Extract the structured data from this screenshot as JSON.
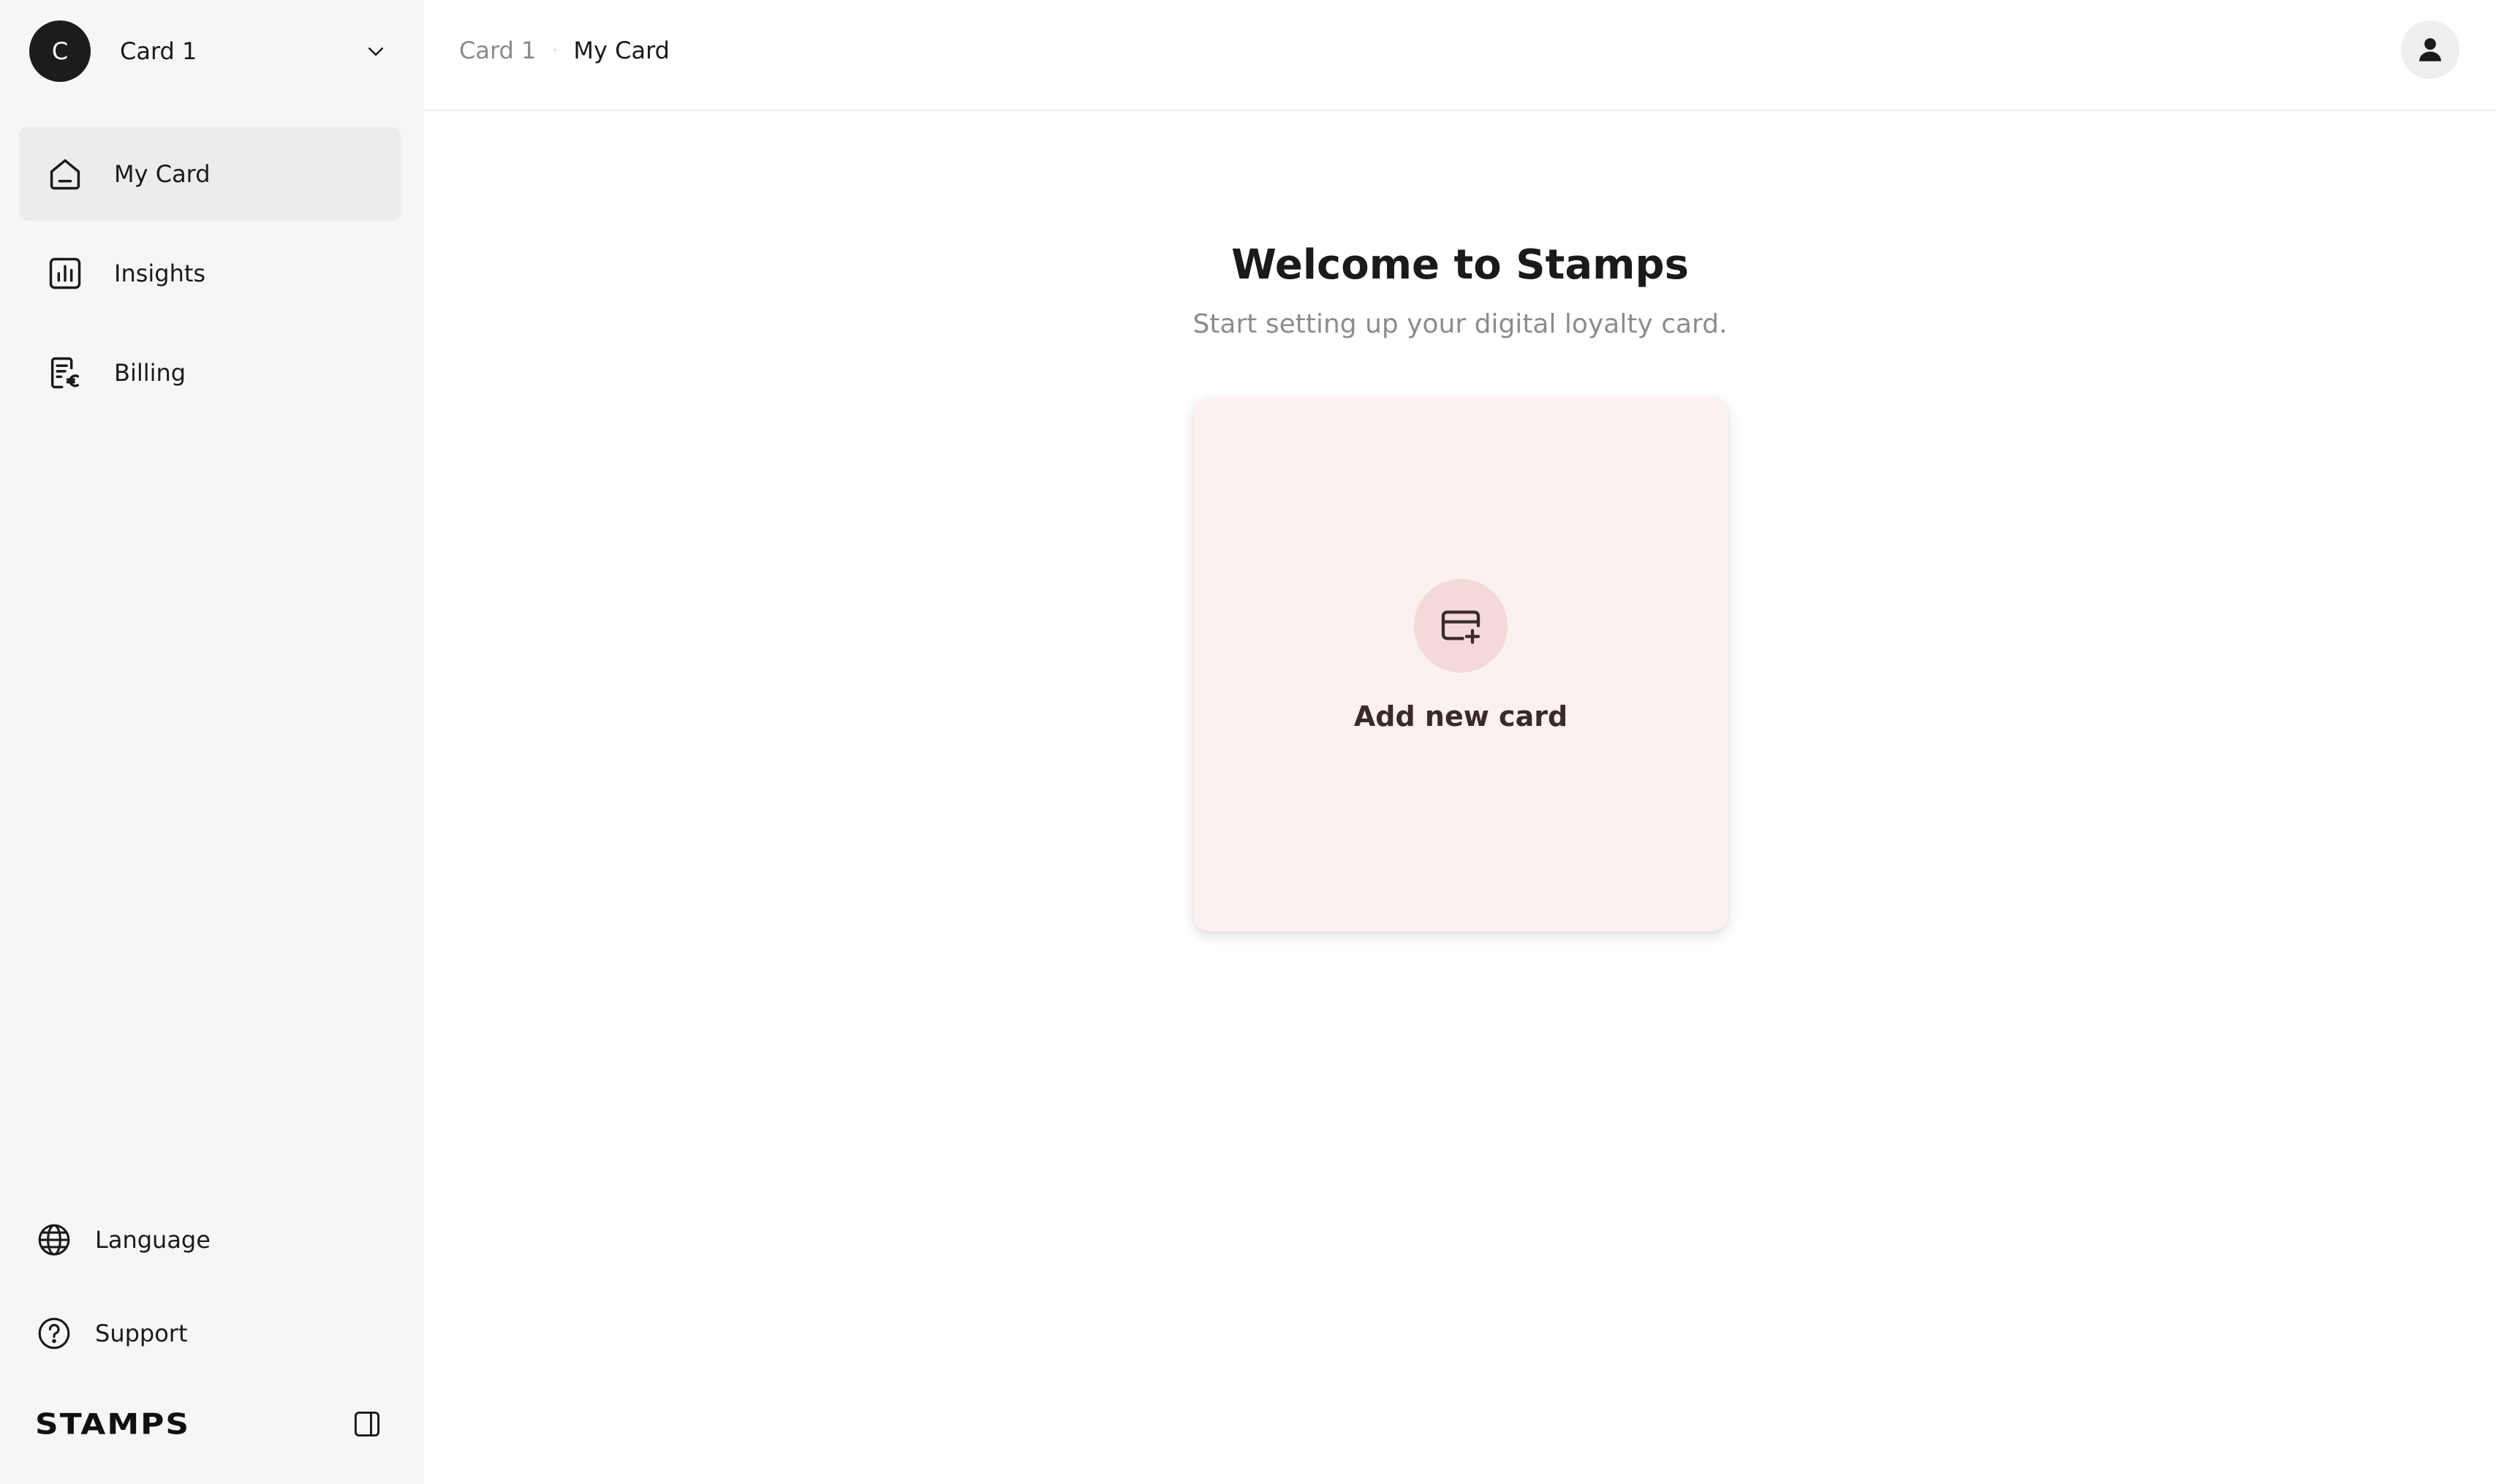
{
  "sidebar": {
    "workspace": {
      "avatar_letter": "C",
      "name": "Card 1"
    },
    "nav_items": [
      {
        "label": "My Card",
        "icon": "home-icon",
        "active": true
      },
      {
        "label": "Insights",
        "icon": "bar-chart-icon",
        "active": false
      },
      {
        "label": "Billing",
        "icon": "receipt-euro-icon",
        "active": false
      }
    ],
    "bottom_items": [
      {
        "label": "Language",
        "icon": "globe-icon"
      },
      {
        "label": "Support",
        "icon": "help-circle-icon"
      }
    ],
    "brand": "STAMPS"
  },
  "header": {
    "breadcrumb": {
      "parent": "Card 1",
      "separator": "·",
      "current": "My Card"
    }
  },
  "main": {
    "title": "Welcome to Stamps",
    "subtitle": "Start setting up your digital loyalty card.",
    "add_card_label": "Add new card"
  },
  "colors": {
    "sidebar_bg": "#f5f7f6",
    "active_nav_bg": "#ebedec",
    "card_bg": "#fbf1f0",
    "card_icon_bg": "#f3d9d7"
  }
}
